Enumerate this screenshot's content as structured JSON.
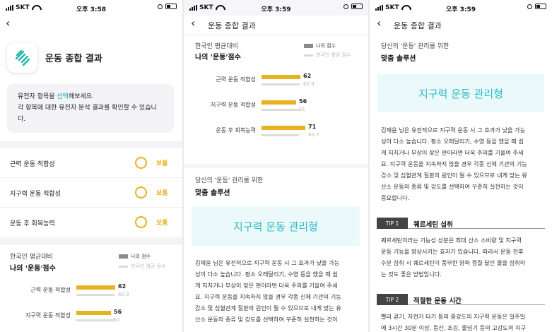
{
  "status_bar": [
    {
      "carrier": "SKT",
      "time": "오후 3:58"
    },
    {
      "carrier": "SKT",
      "time": "오후 3:59"
    },
    {
      "carrier": "SKT",
      "time": "오후 3:59"
    }
  ],
  "screen1": {
    "title": "운동 종합 결과",
    "info_line1_prefix": "유전자 항목을 ",
    "info_line1_link": "선택",
    "info_line1_suffix": "해보세요.",
    "info_line2": "각 항목에 대한 유전자 분석 결과를 확인할 수 있습니",
    "info_line3": "다.",
    "traits": [
      {
        "label": "근력 운동 적합성",
        "grade": "보통"
      },
      {
        "label": "지구력 운동 적합성",
        "grade": "보통"
      },
      {
        "label": "운동 후 회복능력",
        "grade": "보통"
      }
    ]
  },
  "comparison": {
    "subtitle": "한국인 평균대비",
    "title": "나의 '운동'점수",
    "legend_me": "나의 점수",
    "legend_avg": "한국인 평균 점수",
    "colors": {
      "me": "#e6b31e",
      "avg": "#dcdcdc"
    },
    "max": 100
  },
  "chart_data": {
    "type": "bar",
    "categories": [
      "근력 운동 적합성",
      "지구력 운동 적합성",
      "운동 후 회복능력"
    ],
    "series": [
      {
        "name": "나의 점수",
        "values": [
          62,
          56,
          71
        ]
      },
      {
        "name": "한국인 평균 점수",
        "values": [
          60.9,
          61,
          60.7
        ]
      }
    ]
  },
  "screen2": {
    "nav_title": "운동 종합 결과",
    "sol_subtitle": "당신의 '운동' 관리를 위한",
    "sol_title": "맞춤 솔루션",
    "sol_type": "지구력 운동 관리형",
    "body_lines": [
      "김재윤 님은 유전적으로 지구력 운동 시 그 효과가 낮을 가능",
      "성이 다소 높습니다. 평소 오래달리기, 수영 등을 했을 때 쉽",
      "게 지치거나 부상이 잦은 편이라면 더욱 주의를 기울여 주세",
      "요. 지구력 운동을 지속하지 않을 경우 각종 신체 기관의 기능",
      "감소 및 심혈관계 질환의 원인이 될 수 있으므로 내게 맞는 유",
      "산소 운동의 종류 및 강도를 선택하여 꾸준히 실천하는 것이"
    ]
  },
  "screen3": {
    "nav_title": "운동 종합 결과",
    "sol_subtitle": "당신의 '운동' 관리를 위한",
    "sol_title": "맞춤 솔루션",
    "sol_type": "지구력 운동 관리형",
    "body_lines": [
      "김재윤 님은 유전적으로 지구력 운동 시 그 효과가 낮을 가능",
      "성이 다소 높습니다. 평소 오래달리기, 수영 등을 했을 때 쉽",
      "게 지치거나 부상이 잦은 편이라면 더욱 주의를 기울여 주세",
      "요. 지구력 운동을 지속하지 않을 경우 각종 신체 기관의 기능",
      "감소 및 심혈관계 질환의 원인이 될 수 있으므로 내게 맞는 유",
      "산소 운동의 종류 및 강도를 선택하여 꾸준히 실천하는 것이",
      "중요합니다."
    ],
    "tips": [
      {
        "badge": "TIP 1",
        "title": "퀘르세틴 섭취",
        "lines": [
          "퀘르세틴이라는 기능성 성분은 최대 산소 소비량 및 지구력",
          "운동 기능을 향상시키는 효과가 있습니다. 따라서 운동 전후",
          "수분 섭취 시 퀘르세틴이 풍부한 양파 껍질 달인 물을 섭취하",
          "는 것도 좋은 방법입니다."
        ]
      },
      {
        "badge": "TIP 2",
        "title": "적절한 운동 시간",
        "lines": [
          "빨리 걷기, 자전거 타기 등의 중강도의 지구력 운동은 일주일",
          "에 3시간 30분 이상, 등산, 조깅, 줄넘기 등의 고강도의 지구"
        ]
      }
    ]
  }
}
